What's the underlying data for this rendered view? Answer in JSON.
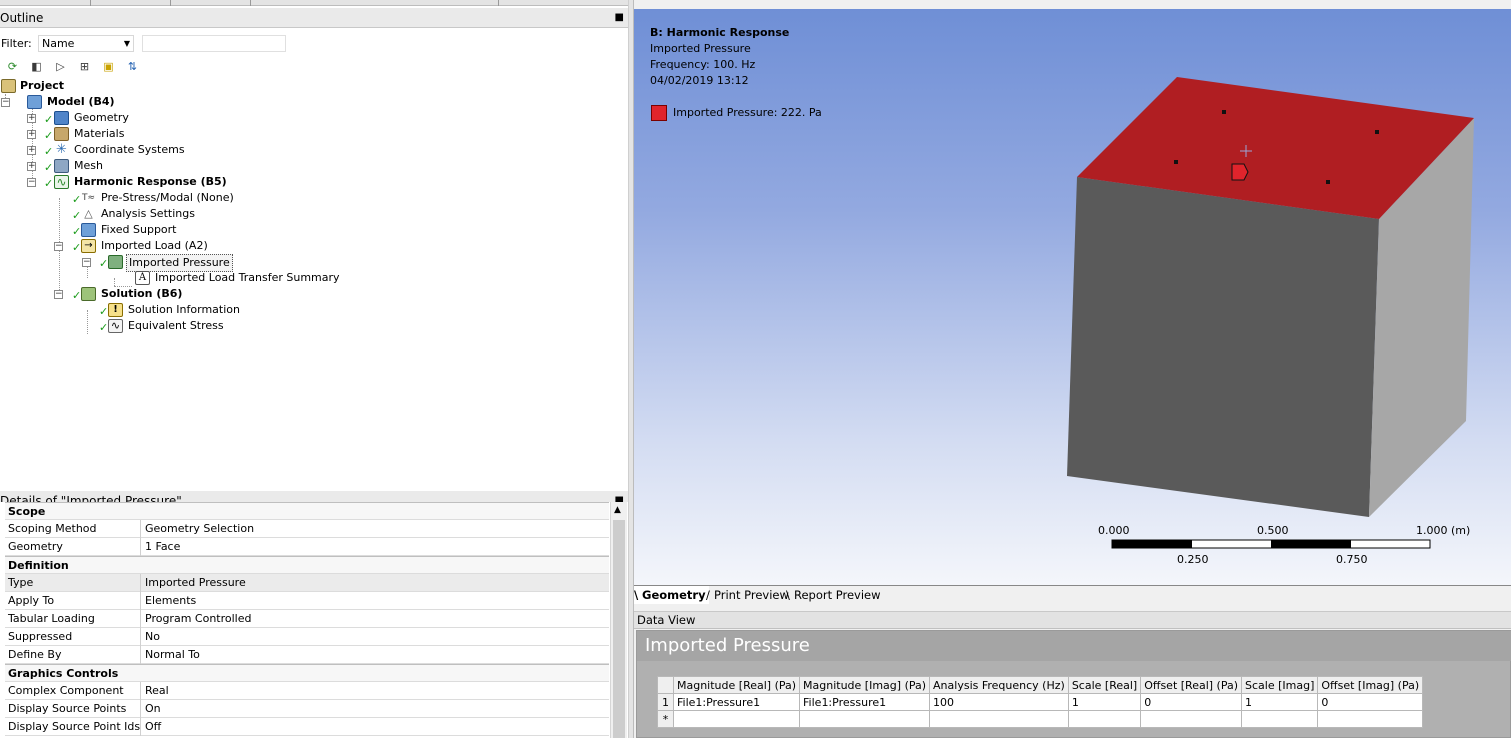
{
  "outline": {
    "title": "Outline",
    "filter_label": "Filter:",
    "filter_value": "Name",
    "filter_text": "",
    "tree": [
      {
        "id": "project",
        "label": "Project",
        "bold": true
      },
      {
        "id": "model",
        "label": "Model (B4)",
        "bold": true
      },
      {
        "id": "geometry",
        "label": "Geometry"
      },
      {
        "id": "materials",
        "label": "Materials"
      },
      {
        "id": "coordinate-systems",
        "label": "Coordinate Systems"
      },
      {
        "id": "mesh",
        "label": "Mesh"
      },
      {
        "id": "harmonic-response",
        "label": "Harmonic Response (B5)",
        "bold": true
      },
      {
        "id": "pre-stress",
        "label": "Pre-Stress/Modal (None)"
      },
      {
        "id": "analysis-settings",
        "label": "Analysis Settings"
      },
      {
        "id": "fixed-support",
        "label": "Fixed Support"
      },
      {
        "id": "imported-load",
        "label": "Imported Load (A2)"
      },
      {
        "id": "imported-pressure",
        "label": "Imported Pressure",
        "selected": true
      },
      {
        "id": "transfer-summary",
        "label": "Imported Load Transfer Summary"
      },
      {
        "id": "solution",
        "label": "Solution (B6)",
        "bold": true
      },
      {
        "id": "solution-information",
        "label": "Solution Information"
      },
      {
        "id": "equivalent-stress",
        "label": "Equivalent Stress"
      }
    ]
  },
  "details": {
    "title": "Details of \"Imported Pressure\"",
    "rows": [
      {
        "key": "Scope",
        "header": true
      },
      {
        "key": "Scoping Method",
        "value": "Geometry Selection"
      },
      {
        "key": "Geometry",
        "value": "1 Face"
      },
      {
        "key": "Definition",
        "header": true
      },
      {
        "key": "Type",
        "value": "Imported Pressure",
        "highlight": true
      },
      {
        "key": "Apply To",
        "value": "Elements"
      },
      {
        "key": "Tabular Loading",
        "value": "Program Controlled"
      },
      {
        "key": "Suppressed",
        "value": "No"
      },
      {
        "key": "Define By",
        "value": "Normal To"
      },
      {
        "key": "Graphics Controls",
        "header": true
      },
      {
        "key": "Complex Component",
        "value": "Real"
      },
      {
        "key": "Display Source Points",
        "value": "On"
      },
      {
        "key": "Display Source Point Ids",
        "value": "Off"
      }
    ]
  },
  "viewport": {
    "title": "B: Harmonic Response",
    "subtitle": "Imported Pressure",
    "frequency": "Frequency: 100. Hz",
    "date": "04/02/2019 13:12",
    "legend": "Imported Pressure: 222. Pa",
    "legend_color": "#e0242c",
    "scale": {
      "top_labels": [
        "0.000",
        "0.500",
        "1.000 (m)"
      ],
      "bottom_labels": [
        "0.250",
        "0.750"
      ]
    }
  },
  "tabs": [
    "Geometry",
    "Print Preview",
    "Report Preview"
  ],
  "data_view": {
    "title": "Data View",
    "heading": "Imported Pressure",
    "columns": [
      "Magnitude [Real] (Pa)",
      "Magnitude [Imag] (Pa)",
      "Analysis Frequency (Hz)",
      "Scale [Real]",
      "Offset [Real] (Pa)",
      "Scale [Imag]",
      "Offset [Imag] (Pa)"
    ],
    "rows": [
      {
        "num": "1",
        "cells": [
          "File1:Pressure1",
          "File1:Pressure1",
          "100",
          "1",
          "0",
          "1",
          "0"
        ]
      },
      {
        "num": "*",
        "cells": [
          "",
          "",
          "",
          "",
          "",
          "",
          ""
        ]
      }
    ]
  }
}
